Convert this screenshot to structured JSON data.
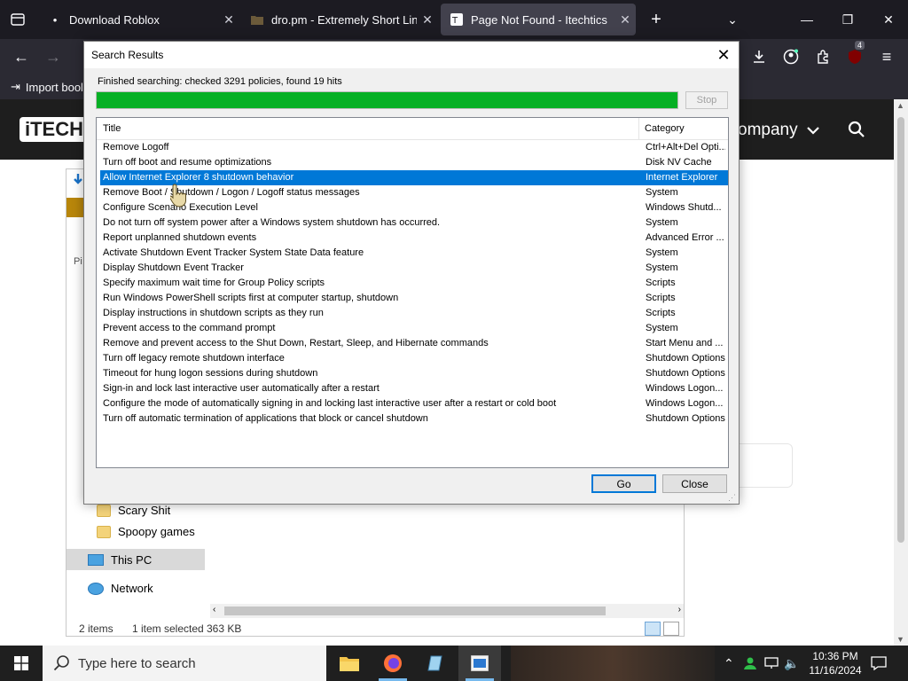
{
  "browser": {
    "tabs": [
      {
        "title": "Download Roblox",
        "active": false
      },
      {
        "title": "dro.pm - Extremely Short Links",
        "active": false
      },
      {
        "title": "Page Not Found - Itechtics",
        "active": true
      }
    ],
    "new_tab_label": "+",
    "bookmark_import_label": "Import bool",
    "extension_badge": "4"
  },
  "site": {
    "logo_text": "iTECH",
    "nav_item": "ompany"
  },
  "explorer": {
    "side_partial_label": "Pi",
    "sidebar": [
      {
        "label": "Scary Shit"
      },
      {
        "label": "Spoopy games"
      },
      {
        "label": "This PC"
      },
      {
        "label": "Network"
      }
    ],
    "status": {
      "items": "2 items",
      "selected": "1 item selected",
      "size": "363 KB"
    }
  },
  "dialog": {
    "title": "Search Results",
    "status_text": "Finished searching: checked 3291 policies, found 19 hits",
    "progress_percent": 100,
    "progress_color": "#06b025",
    "stop_label": "Stop",
    "columns": [
      "Title",
      "Category"
    ],
    "rows": [
      {
        "title": "Remove Logoff",
        "category": "Ctrl+Alt+Del Opti..."
      },
      {
        "title": "Turn off boot and resume optimizations",
        "category": "Disk NV Cache"
      },
      {
        "title": "Allow Internet Explorer 8 shutdown behavior",
        "category": "Internet Explorer",
        "selected": true
      },
      {
        "title": "Remove Boot / Shutdown / Logon / Logoff status messages",
        "category": "System"
      },
      {
        "title": "Configure Scenario Execution Level",
        "category": "Windows Shutd..."
      },
      {
        "title": "Do not turn off system power after a Windows system shutdown has occurred.",
        "category": "System"
      },
      {
        "title": "Report unplanned shutdown events",
        "category": "Advanced Error ..."
      },
      {
        "title": "Activate Shutdown Event Tracker System State Data feature",
        "category": "System"
      },
      {
        "title": "Display Shutdown Event Tracker",
        "category": "System"
      },
      {
        "title": "Specify maximum wait time for Group Policy scripts",
        "category": "Scripts"
      },
      {
        "title": "Run Windows PowerShell scripts first at computer startup, shutdown",
        "category": "Scripts"
      },
      {
        "title": "Display instructions in shutdown scripts as they run",
        "category": "Scripts"
      },
      {
        "title": "Prevent access to the command prompt",
        "category": "System"
      },
      {
        "title": "Remove and prevent access to the Shut Down, Restart, Sleep, and Hibernate commands",
        "category": "Start Menu and ..."
      },
      {
        "title": "Turn off legacy remote shutdown interface",
        "category": "Shutdown Options"
      },
      {
        "title": "Timeout for hung logon sessions during shutdown",
        "category": "Shutdown Options"
      },
      {
        "title": "Sign-in and lock last interactive user automatically after a restart",
        "category": "Windows Logon..."
      },
      {
        "title": "Configure the mode of automatically signing in and locking last interactive user after a restart or cold boot",
        "category": "Windows Logon..."
      },
      {
        "title": "Turn off automatic termination of applications that block or cancel shutdown",
        "category": "Shutdown Options"
      }
    ],
    "go_label": "Go",
    "close_label": "Close",
    "selection_color": "#0078d7"
  },
  "taskbar": {
    "search_placeholder": "Type here to search",
    "time": "10:36 PM",
    "date": "11/16/2024"
  }
}
